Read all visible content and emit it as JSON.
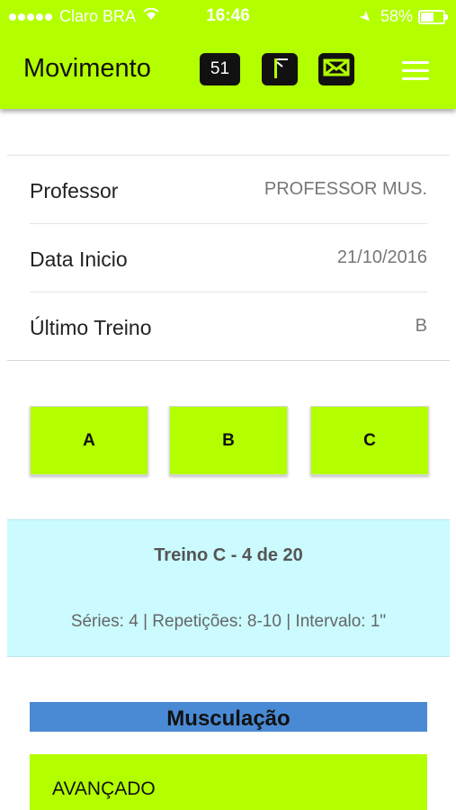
{
  "status_bar": {
    "carrier": "Claro BRA",
    "time": "16:46",
    "battery": "58%",
    "battery_level": 0.58
  },
  "header": {
    "title": "Movimento",
    "badge_count": "51",
    "icons": [
      "gate-icon",
      "mail-icon",
      "menu-icon"
    ]
  },
  "info": {
    "professor_label": "Professor",
    "professor_value": "PROFESSOR MUS.",
    "start_label": "Data Inicio",
    "start_value": "21/10/2016",
    "last_label": "Último Treino",
    "last_value": "B"
  },
  "workouts": [
    "A",
    "B",
    "C"
  ],
  "summary": {
    "title": "Treino C - 4 de 20",
    "details": "Séries: 4 | Repetições: 8-10 | Intervalo: 1\""
  },
  "category": "Musculação",
  "level": "AVANÇADO",
  "colors": {
    "accent": "#b3ff00",
    "summary_bg": "#cbfbff",
    "category_bg": "#4a8ad4"
  }
}
